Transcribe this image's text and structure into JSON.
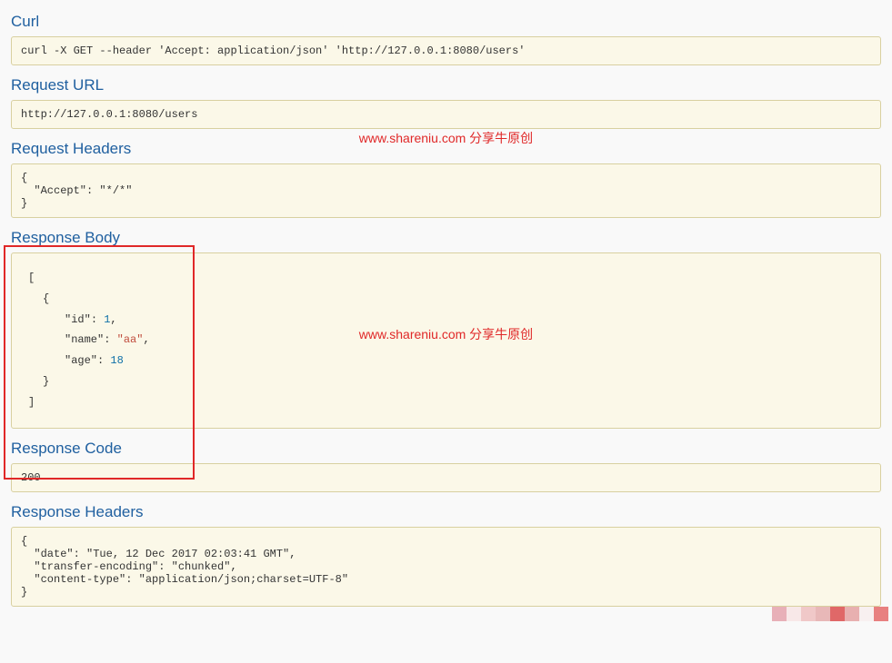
{
  "watermark": "www.shareniu.com 分享牛原创",
  "sections": {
    "curl": {
      "title": "Curl",
      "content": "curl -X GET --header 'Accept: application/json' 'http://127.0.0.1:8080/users'"
    },
    "request_url": {
      "title": "Request URL",
      "content": "http://127.0.0.1:8080/users"
    },
    "request_headers": {
      "title": "Request Headers",
      "content": "{\n  \"Accept\": \"*/*\"\n}"
    },
    "response_body": {
      "title": "Response Body",
      "json": {
        "open_bracket": "[",
        "open_brace": "{",
        "id_key": "\"id\"",
        "id_colon": ": ",
        "id_val": "1",
        "id_trail": ",",
        "name_key": "\"name\"",
        "name_colon": ": ",
        "name_val": "\"aa\"",
        "name_trail": ",",
        "age_key": "\"age\"",
        "age_colon": ": ",
        "age_val": "18",
        "close_brace": "}",
        "close_bracket": "]"
      }
    },
    "response_code": {
      "title": "Response Code",
      "content": "200"
    },
    "response_headers": {
      "title": "Response Headers",
      "content": "{\n  \"date\": \"Tue, 12 Dec 2017 02:03:41 GMT\",\n  \"transfer-encoding\": \"chunked\",\n  \"content-type\": \"application/json;charset=UTF-8\"\n}"
    }
  },
  "pixel_colors": [
    "#e8b0b8",
    "#f8e8e8",
    "#f0c8c8",
    "#e8b8b8",
    "#e06868",
    "#e8b0b0",
    "#f8f0f0",
    "#e88080"
  ]
}
